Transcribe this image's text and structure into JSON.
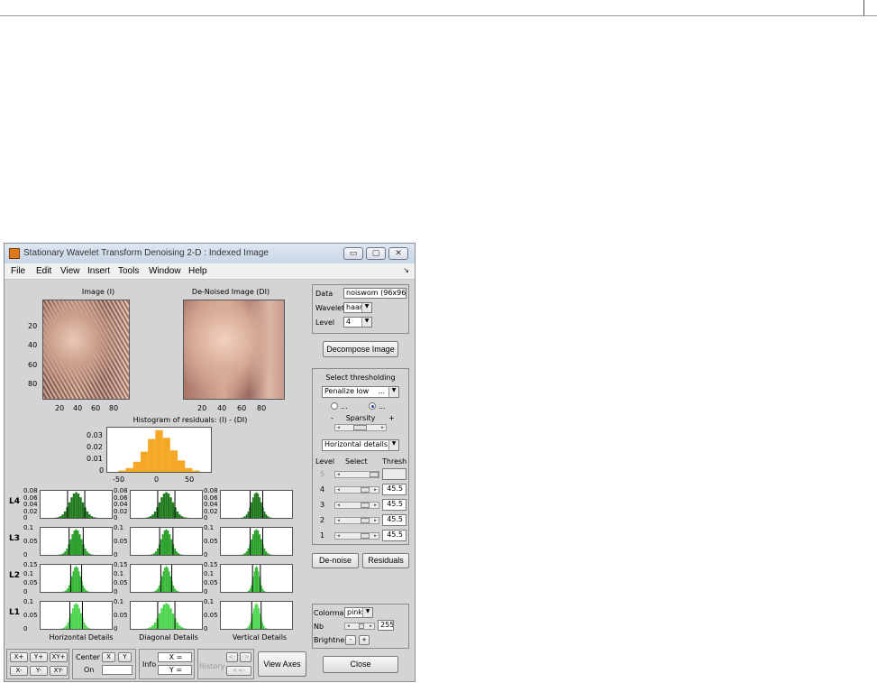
{
  "window": {
    "title": "Stationary Wavelet Transform Denoising 2-D : Indexed Image",
    "controls": [
      "▭",
      "▢",
      "✕"
    ]
  },
  "menu": [
    "File",
    "Edit",
    "View",
    "Insert",
    "Tools",
    "Window",
    "Help"
  ],
  "plots": {
    "image_title": "Image (I)",
    "denoised_title": "De-Noised Image (DI)",
    "image_y_ticks": [
      "20",
      "40",
      "60",
      "80"
    ],
    "image_x_ticks": [
      "20",
      "40",
      "60",
      "80"
    ],
    "hist_title": "Histogram of residuals: (I) - (DI)",
    "hist_y_ticks": [
      "0.03",
      "0.02",
      "0.01",
      "0"
    ],
    "hist_x_ticks": [
      "-50",
      "0",
      "50"
    ],
    "level_labels": [
      "L4",
      "L3",
      "L2",
      "L1"
    ],
    "level_y_ticks": [
      [
        "0.08",
        "0.06",
        "0.04",
        "0.02",
        "0"
      ],
      [
        "0.1",
        "0.05",
        "0"
      ],
      [
        "0.15",
        "0.1",
        "0.05",
        "0"
      ],
      [
        "0.1",
        "0.05",
        "0"
      ]
    ],
    "col_titles": [
      "Horizontal Details",
      "Diagonal Details",
      "Vertical Details"
    ]
  },
  "chart_data": {
    "type": "bar",
    "title": "Histogram of residuals: (I) - (DI)",
    "x": [
      -60,
      -50,
      -40,
      -30,
      -20,
      -10,
      0,
      10,
      20,
      30,
      40,
      50,
      60
    ],
    "values": [
      0.0,
      0.001,
      0.003,
      0.008,
      0.016,
      0.026,
      0.033,
      0.027,
      0.017,
      0.009,
      0.003,
      0.001,
      0.0
    ],
    "xlim": [
      -70,
      70
    ],
    "ylim": [
      0,
      0.035
    ],
    "color": "#f4a825"
  },
  "right_panel": {
    "data_label": "Data",
    "data_value": "noiswom (96x96)",
    "wavelet_label": "Wavelet",
    "wavelet_value": "haar",
    "level_label": "Level",
    "level_value": "4",
    "decompose_btn": "Decompose Image",
    "select_thresholding": "Select thresholding",
    "method_value": "Penalize low",
    "method_more": "...",
    "radio1": "...",
    "radio2": "...",
    "minus": "-",
    "sparsity": "Sparsity",
    "plus": "+",
    "direction_value": "Horizontal details...",
    "col_level": "Level",
    "col_select": "Select",
    "col_thresh": "Thresh",
    "levels": [
      {
        "n": "5",
        "thresh": ""
      },
      {
        "n": "4",
        "thresh": "45.5"
      },
      {
        "n": "3",
        "thresh": "45.5"
      },
      {
        "n": "2",
        "thresh": "45.5"
      },
      {
        "n": "1",
        "thresh": "45.5"
      }
    ],
    "denoise_btn": "De-noise",
    "residuals_btn": "Residuals",
    "colormap_label": "Colormap",
    "colormap_value": "pink",
    "nb_label": "Nb",
    "nb_value": "255",
    "brightness_label": "Brightne",
    "bright_minus": "-",
    "bright_plus": "+",
    "close_btn": "Close"
  },
  "bottom": {
    "xplus": "X+",
    "yplus": "Y+",
    "xyplus": "XY+",
    "xminus": "X-",
    "yminus": "Y-",
    "xyminus": "XY-",
    "center_label": "Center",
    "on_label": "On",
    "center_x": "X",
    "center_y": "Y",
    "info_label": "Info",
    "info_x": "X =",
    "info_y": "Y =",
    "hist_back": "<-",
    "hist_fwd": "->",
    "hist_label": "History",
    "hist_first": "<<-",
    "view_axes": "View Axes"
  }
}
